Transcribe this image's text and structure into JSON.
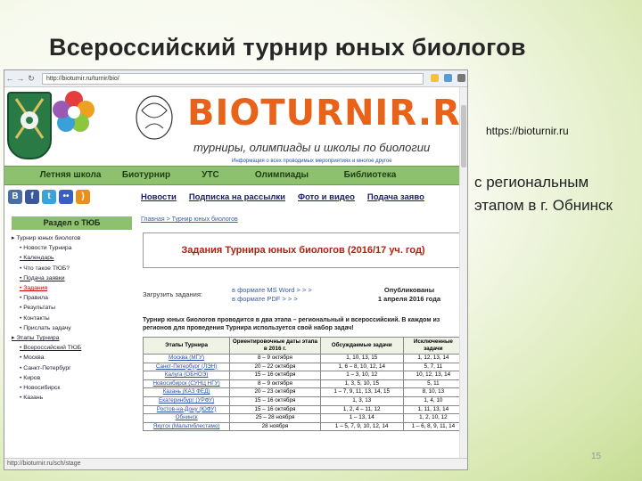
{
  "slide": {
    "title": "Всероссийский турнир юных биологов",
    "url_label": "https://bioturnir.ru",
    "regional_text": "с региональным этапом в г. Обнинск",
    "page_number": "15"
  },
  "browser": {
    "address": "http://bioturnir.ru/turnir/bio/",
    "status_text": "http://bioturnir.ru/sch/stage"
  },
  "site": {
    "wordmark": "BIOTURNIR.RU",
    "tagline": "турниры, олимпиады и школы по биологии",
    "info_line": "Информация о всех проводимых мероприятиях и многое другое",
    "top_nav": [
      "Летняя школа",
      "Биотурнир",
      "УТС",
      "Олимпиады",
      "Библиотека"
    ],
    "social": [
      {
        "label": "B",
        "color": "#4a6fa5"
      },
      {
        "label": "f",
        "color": "#3b5998"
      },
      {
        "label": "t",
        "color": "#3aa3d8"
      },
      {
        "label": "••",
        "color": "#3b5ec4"
      },
      {
        "label": ")",
        "color": "#e8901a"
      }
    ],
    "sub_nav": [
      "Новости",
      "Подписка на рассылки",
      "Фото и видео",
      "Подача заяво"
    ],
    "sidebar": {
      "heading": "Раздел о ТЮБ",
      "items": [
        {
          "text": "Турнир юных биологов",
          "cls": "l0"
        },
        {
          "text": "Новости Турнира",
          "cls": "l1"
        },
        {
          "text": "Календарь",
          "cls": "l1 u"
        },
        {
          "text": "Что такое ТЮБ?",
          "cls": "l1"
        },
        {
          "text": "Подача заявки",
          "cls": "l1 u"
        },
        {
          "text": "Задания",
          "cls": "l1 red"
        },
        {
          "text": "Правила",
          "cls": "l1"
        },
        {
          "text": "Результаты",
          "cls": "l1"
        },
        {
          "text": "Контакты",
          "cls": "l1"
        },
        {
          "text": "Прислать задачу",
          "cls": "l1"
        },
        {
          "text": "Этапы Турнира",
          "cls": "l0 u"
        },
        {
          "text": "Всероссийский ТЮБ",
          "cls": "l1 u"
        },
        {
          "text": "Москва",
          "cls": "l1"
        },
        {
          "text": "Санкт-Петербург",
          "cls": "l1"
        },
        {
          "text": "Киров",
          "cls": "l1"
        },
        {
          "text": "Новосибирск",
          "cls": "l1"
        },
        {
          "text": "Казань",
          "cls": "l1"
        }
      ]
    },
    "breadcrumb": "Главная > Турнир юных биологов",
    "content_title": "Задания Турнира юных биологов (2016/17 уч. год)",
    "download": {
      "label": "Загрузить задания:",
      "word": "в формате MS Word > > >",
      "pdf": "в формате PDF > > >",
      "published": "Опубликованы",
      "date": "1 апреля 2016 года"
    },
    "paragraph": "Турнир юных биологов проводится в два этапа – региональный и всероссийский. В каждом из регионов для проведения Турнира используется свой набор задач!",
    "table": {
      "headers": [
        "Этапы Турнира",
        "Ориентировочные даты этапа в 2016 г.",
        "Обсуждаемые задачи",
        "Исключенные задачи"
      ],
      "rows": [
        [
          "Москва (МГУ)",
          "8 – 9 октября",
          "1, 10, 13, 15",
          "1, 12, 13, 14"
        ],
        [
          "Санкт-Петербург (ЛЭН)",
          "20 – 22 октября",
          "1, 6 – 8, 10, 12, 14",
          "5, 7, 11"
        ],
        [
          "Калуга (ОБНОЭ)",
          "15 – 16 октября",
          "1 – 3, 10, 12",
          "10, 12, 13, 14"
        ],
        [
          "Новосибирск (СУНЦ НГУ)",
          "8 – 9 октября",
          "1, 3, 5, 10, 15",
          "5, 11"
        ],
        [
          "Казань (КАЗ ФЕД)",
          "20 – 23 октября",
          "1 – 7, 9, 11, 13, 14, 15",
          "8, 10, 13"
        ],
        [
          "Екатеринбург (УРФУ)",
          "15 – 16 октября",
          "1, 3, 13",
          "1, 4, 10"
        ],
        [
          "Ростов-на-Дону (ЮФУ)",
          "15 – 16 октября",
          "1, 2, 4 – 11, 12",
          "1, 11, 13, 14"
        ],
        [
          "Обнинск",
          "25 – 28 ноября",
          "1 – 13, 14",
          "1, 2, 10, 12"
        ],
        [
          "Якутск (Мальтиблестамо)",
          "28 ноября",
          "1 – 5, 7, 9, 10, 12, 14",
          "1 – 6, 8, 9, 11, 14"
        ]
      ]
    }
  }
}
